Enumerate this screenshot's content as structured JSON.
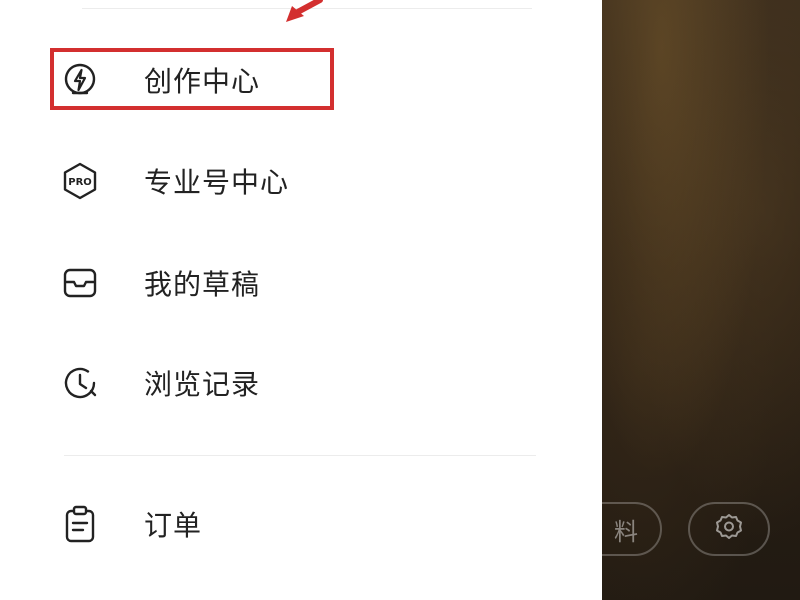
{
  "menu": {
    "items": [
      {
        "label": "创作中心",
        "icon": "lightning-bolt-icon"
      },
      {
        "label": "专业号中心",
        "icon": "pro-badge-icon"
      },
      {
        "label": "我的草稿",
        "icon": "drafts-box-icon"
      },
      {
        "label": "浏览记录",
        "icon": "history-clock-icon"
      }
    ],
    "secondary": [
      {
        "label": "订单",
        "icon": "clipboard-icon"
      }
    ],
    "pro_badge_text": "PRO"
  },
  "background": {
    "edit_profile_label": "料",
    "settings_icon": "gear-icon"
  },
  "annotation": {
    "highlight_color": "#d32f2f"
  }
}
